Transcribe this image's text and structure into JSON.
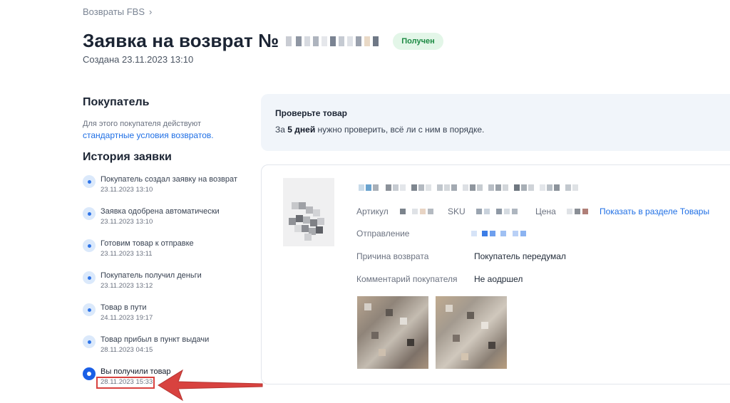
{
  "breadcrumb": {
    "label": "Возвраты FBS",
    "chevron": "›"
  },
  "header": {
    "title": "Заявка на возврат №",
    "status": "Получен",
    "created": "Создана 23.11.2023 13:10"
  },
  "buyer": {
    "title": "Покупатель",
    "note": "Для этого покупателя действуют",
    "link": "стандартные условия возвратов."
  },
  "history": {
    "title": "История заявки",
    "events": [
      {
        "text": "Покупатель создал заявку на возврат",
        "time": "23.11.2023 13:10"
      },
      {
        "text": "Заявка одобрена автоматически",
        "time": "23.11.2023 13:10"
      },
      {
        "text": "Готовим товар к отправке",
        "time": "23.11.2023 13:11"
      },
      {
        "text": "Покупатель получил деньги",
        "time": "23.11.2023 13:12"
      },
      {
        "text": "Товар в пути",
        "time": "24.11.2023 19:17"
      },
      {
        "text": "Товар прибыл в пункт выдачи",
        "time": "28.11.2023 04:15"
      },
      {
        "text": "Вы получили товар",
        "time": "28.11.2023 15:33"
      }
    ]
  },
  "check": {
    "title": "Проверьте товар",
    "prefix": "За",
    "days": "5 дней",
    "suffix": "нужно проверить, всё ли с ним в порядке."
  },
  "product": {
    "article_label": "Артикул",
    "sku_label": "SKU",
    "price_label": "Цена",
    "show_link": "Показать в разделе Товары",
    "shipment_label": "Отправление",
    "reason_label": "Причина возврата",
    "reason_value": "Покупатель передумал",
    "comment_label": "Комментарий покупателя",
    "comment_value": "Не аодршел"
  },
  "colors": {
    "accent": "#1f6fe5",
    "status_bg": "#e3f6e8",
    "status_text": "#1c8a43",
    "annotation": "#d8423f"
  }
}
